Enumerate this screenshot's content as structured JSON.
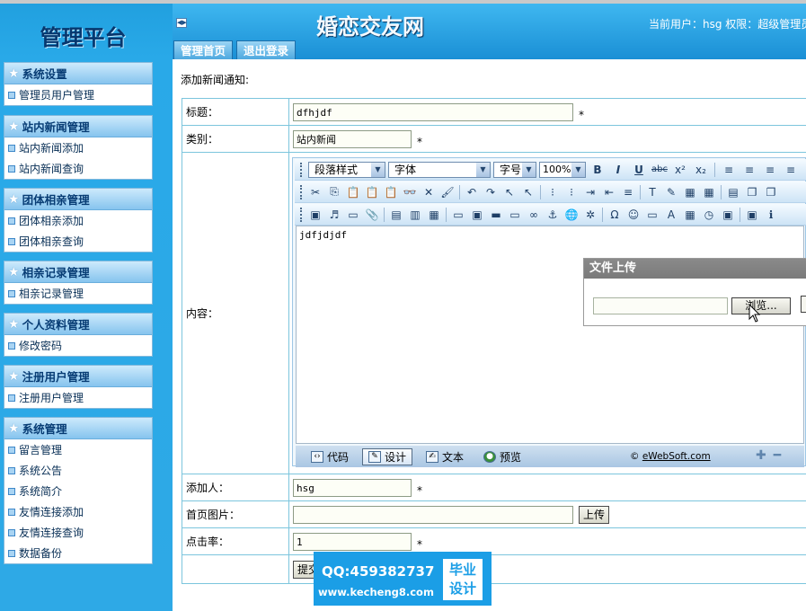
{
  "sidebar": {
    "logo": "管理平台",
    "groups": [
      {
        "title": "系统设置",
        "items": [
          "管理员用户管理"
        ]
      },
      {
        "title": "站内新闻管理",
        "items": [
          "站内新闻添加",
          "站内新闻查询"
        ]
      },
      {
        "title": "团体相亲管理",
        "items": [
          "团体相亲添加",
          "团体相亲查询"
        ]
      },
      {
        "title": "相亲记录管理",
        "items": [
          "相亲记录管理"
        ]
      },
      {
        "title": "个人资料管理",
        "items": [
          "修改密码"
        ]
      },
      {
        "title": "注册用户管理",
        "items": [
          "注册用户管理"
        ]
      },
      {
        "title": "系统管理",
        "items": [
          "留言管理",
          "系统公告",
          "系统简介",
          "友情连接添加",
          "友情连接查询",
          "数据备份"
        ]
      }
    ]
  },
  "header": {
    "collapse_glyph": "◀▶",
    "site_title": "婚恋交友网",
    "user_info": "当前用户：hsg 权限：超级管理员",
    "tabs": [
      "管理首页",
      "退出登录"
    ]
  },
  "page": {
    "title": "添加新闻通知:"
  },
  "form": {
    "title_label": "标题：",
    "title_value": "dfhjdf",
    "category_label": "类别：",
    "category_value": "站内新闻",
    "content_label": "内容：",
    "content_value": "jdfjdjdf",
    "author_label": "添加人：",
    "author_value": "hsg",
    "image_label": "首页图片：",
    "image_value": "",
    "upload_button": "上传",
    "clicks_label": "点击率：",
    "clicks_value": "1",
    "submit_button": "提交",
    "required_mark": "*"
  },
  "editor": {
    "paragraph_select": "段落样式",
    "font_select": "字体",
    "size_select": "字号",
    "zoom_select": "100%",
    "modes": [
      {
        "label": "代码",
        "icon": "code-icon"
      },
      {
        "label": "设计",
        "icon": "design-icon"
      },
      {
        "label": "文本",
        "icon": "text-icon"
      },
      {
        "label": "预览",
        "icon": "preview-icon"
      }
    ],
    "credit_prefix": "©",
    "credit_link": "eWebSoft.com",
    "toolbar1": [
      "B",
      "I",
      "U",
      "abc",
      "x²",
      "x₂",
      "≡",
      "≡",
      "≡",
      "≡"
    ],
    "toolbar2": [
      "✂",
      "⎘",
      "📋",
      "📋",
      "📋",
      "👓",
      "✕",
      "🖌",
      "↶",
      "↷",
      "↖",
      "↖",
      "⁝",
      "⁝",
      "⇥",
      "⇤",
      "≡",
      "T",
      "✎",
      "▦",
      "▦",
      "▤",
      "❐",
      "❐"
    ],
    "toolbar3": [
      "▣",
      "♬",
      "▭",
      "📎",
      "▤",
      "▥",
      "▦",
      "▭",
      "▣",
      "▬",
      "▭",
      "∞",
      "⚓",
      "🌐",
      "✲",
      "Ω",
      "☺",
      "▭",
      "A",
      "▦",
      "◷",
      "▣",
      "▣",
      "ℹ"
    ]
  },
  "upload_dialog": {
    "title": "文件上传",
    "browse_button": "浏览..."
  },
  "watermark": {
    "qq": "QQ:459382737",
    "url": "www.kecheng8.com",
    "badge_line1": "毕业",
    "badge_line2": "设计"
  },
  "colors": {
    "sidebar_blue": "#29a9e8",
    "header_blue": "#1a8fd5",
    "table_border": "#7cc5dd",
    "watermark_blue": "#1b9ee6"
  }
}
